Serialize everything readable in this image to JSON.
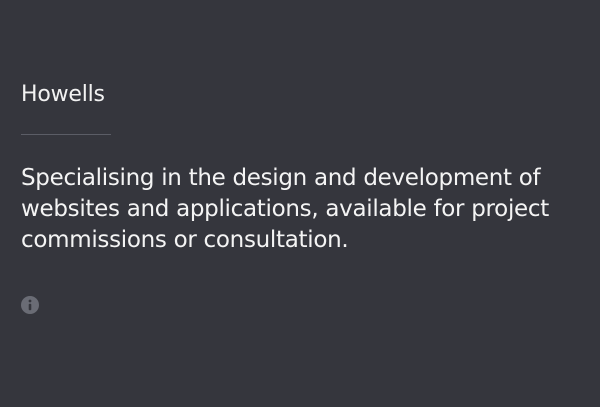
{
  "brand": {
    "name": "Howells"
  },
  "intro": {
    "text": "Specialising in the design and development of websites and applications, available for project commissions or consultation."
  },
  "icons": {
    "info": "info-icon"
  },
  "colors": {
    "background": "#35363d",
    "text": "#f2f2f2",
    "divider": "#5b5d66",
    "icon": "#6a6c75"
  }
}
